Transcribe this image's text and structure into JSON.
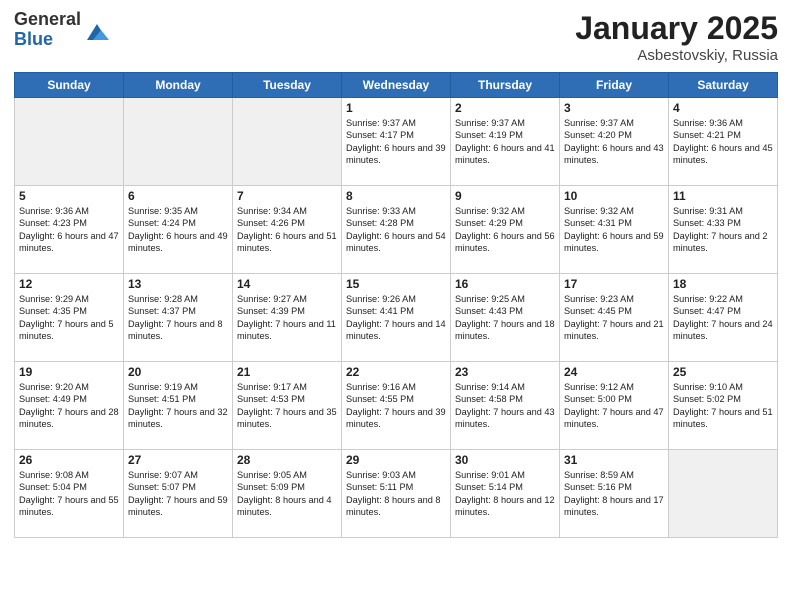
{
  "header": {
    "logo_general": "General",
    "logo_blue": "Blue",
    "title": "January 2025",
    "location": "Asbestovskiy, Russia"
  },
  "days_of_week": [
    "Sunday",
    "Monday",
    "Tuesday",
    "Wednesday",
    "Thursday",
    "Friday",
    "Saturday"
  ],
  "weeks": [
    [
      {
        "date": "",
        "info": ""
      },
      {
        "date": "",
        "info": ""
      },
      {
        "date": "",
        "info": ""
      },
      {
        "date": "1",
        "info": "Sunrise: 9:37 AM\nSunset: 4:17 PM\nDaylight: 6 hours\nand 39 minutes."
      },
      {
        "date": "2",
        "info": "Sunrise: 9:37 AM\nSunset: 4:19 PM\nDaylight: 6 hours\nand 41 minutes."
      },
      {
        "date": "3",
        "info": "Sunrise: 9:37 AM\nSunset: 4:20 PM\nDaylight: 6 hours\nand 43 minutes."
      },
      {
        "date": "4",
        "info": "Sunrise: 9:36 AM\nSunset: 4:21 PM\nDaylight: 6 hours\nand 45 minutes."
      }
    ],
    [
      {
        "date": "5",
        "info": "Sunrise: 9:36 AM\nSunset: 4:23 PM\nDaylight: 6 hours\nand 47 minutes."
      },
      {
        "date": "6",
        "info": "Sunrise: 9:35 AM\nSunset: 4:24 PM\nDaylight: 6 hours\nand 49 minutes."
      },
      {
        "date": "7",
        "info": "Sunrise: 9:34 AM\nSunset: 4:26 PM\nDaylight: 6 hours\nand 51 minutes."
      },
      {
        "date": "8",
        "info": "Sunrise: 9:33 AM\nSunset: 4:28 PM\nDaylight: 6 hours\nand 54 minutes."
      },
      {
        "date": "9",
        "info": "Sunrise: 9:32 AM\nSunset: 4:29 PM\nDaylight: 6 hours\nand 56 minutes."
      },
      {
        "date": "10",
        "info": "Sunrise: 9:32 AM\nSunset: 4:31 PM\nDaylight: 6 hours\nand 59 minutes."
      },
      {
        "date": "11",
        "info": "Sunrise: 9:31 AM\nSunset: 4:33 PM\nDaylight: 7 hours\nand 2 minutes."
      }
    ],
    [
      {
        "date": "12",
        "info": "Sunrise: 9:29 AM\nSunset: 4:35 PM\nDaylight: 7 hours\nand 5 minutes."
      },
      {
        "date": "13",
        "info": "Sunrise: 9:28 AM\nSunset: 4:37 PM\nDaylight: 7 hours\nand 8 minutes."
      },
      {
        "date": "14",
        "info": "Sunrise: 9:27 AM\nSunset: 4:39 PM\nDaylight: 7 hours\nand 11 minutes."
      },
      {
        "date": "15",
        "info": "Sunrise: 9:26 AM\nSunset: 4:41 PM\nDaylight: 7 hours\nand 14 minutes."
      },
      {
        "date": "16",
        "info": "Sunrise: 9:25 AM\nSunset: 4:43 PM\nDaylight: 7 hours\nand 18 minutes."
      },
      {
        "date": "17",
        "info": "Sunrise: 9:23 AM\nSunset: 4:45 PM\nDaylight: 7 hours\nand 21 minutes."
      },
      {
        "date": "18",
        "info": "Sunrise: 9:22 AM\nSunset: 4:47 PM\nDaylight: 7 hours\nand 24 minutes."
      }
    ],
    [
      {
        "date": "19",
        "info": "Sunrise: 9:20 AM\nSunset: 4:49 PM\nDaylight: 7 hours\nand 28 minutes."
      },
      {
        "date": "20",
        "info": "Sunrise: 9:19 AM\nSunset: 4:51 PM\nDaylight: 7 hours\nand 32 minutes."
      },
      {
        "date": "21",
        "info": "Sunrise: 9:17 AM\nSunset: 4:53 PM\nDaylight: 7 hours\nand 35 minutes."
      },
      {
        "date": "22",
        "info": "Sunrise: 9:16 AM\nSunset: 4:55 PM\nDaylight: 7 hours\nand 39 minutes."
      },
      {
        "date": "23",
        "info": "Sunrise: 9:14 AM\nSunset: 4:58 PM\nDaylight: 7 hours\nand 43 minutes."
      },
      {
        "date": "24",
        "info": "Sunrise: 9:12 AM\nSunset: 5:00 PM\nDaylight: 7 hours\nand 47 minutes."
      },
      {
        "date": "25",
        "info": "Sunrise: 9:10 AM\nSunset: 5:02 PM\nDaylight: 7 hours\nand 51 minutes."
      }
    ],
    [
      {
        "date": "26",
        "info": "Sunrise: 9:08 AM\nSunset: 5:04 PM\nDaylight: 7 hours\nand 55 minutes."
      },
      {
        "date": "27",
        "info": "Sunrise: 9:07 AM\nSunset: 5:07 PM\nDaylight: 7 hours\nand 59 minutes."
      },
      {
        "date": "28",
        "info": "Sunrise: 9:05 AM\nSunset: 5:09 PM\nDaylight: 8 hours\nand 4 minutes."
      },
      {
        "date": "29",
        "info": "Sunrise: 9:03 AM\nSunset: 5:11 PM\nDaylight: 8 hours\nand 8 minutes."
      },
      {
        "date": "30",
        "info": "Sunrise: 9:01 AM\nSunset: 5:14 PM\nDaylight: 8 hours\nand 12 minutes."
      },
      {
        "date": "31",
        "info": "Sunrise: 8:59 AM\nSunset: 5:16 PM\nDaylight: 8 hours\nand 17 minutes."
      },
      {
        "date": "",
        "info": ""
      }
    ]
  ]
}
